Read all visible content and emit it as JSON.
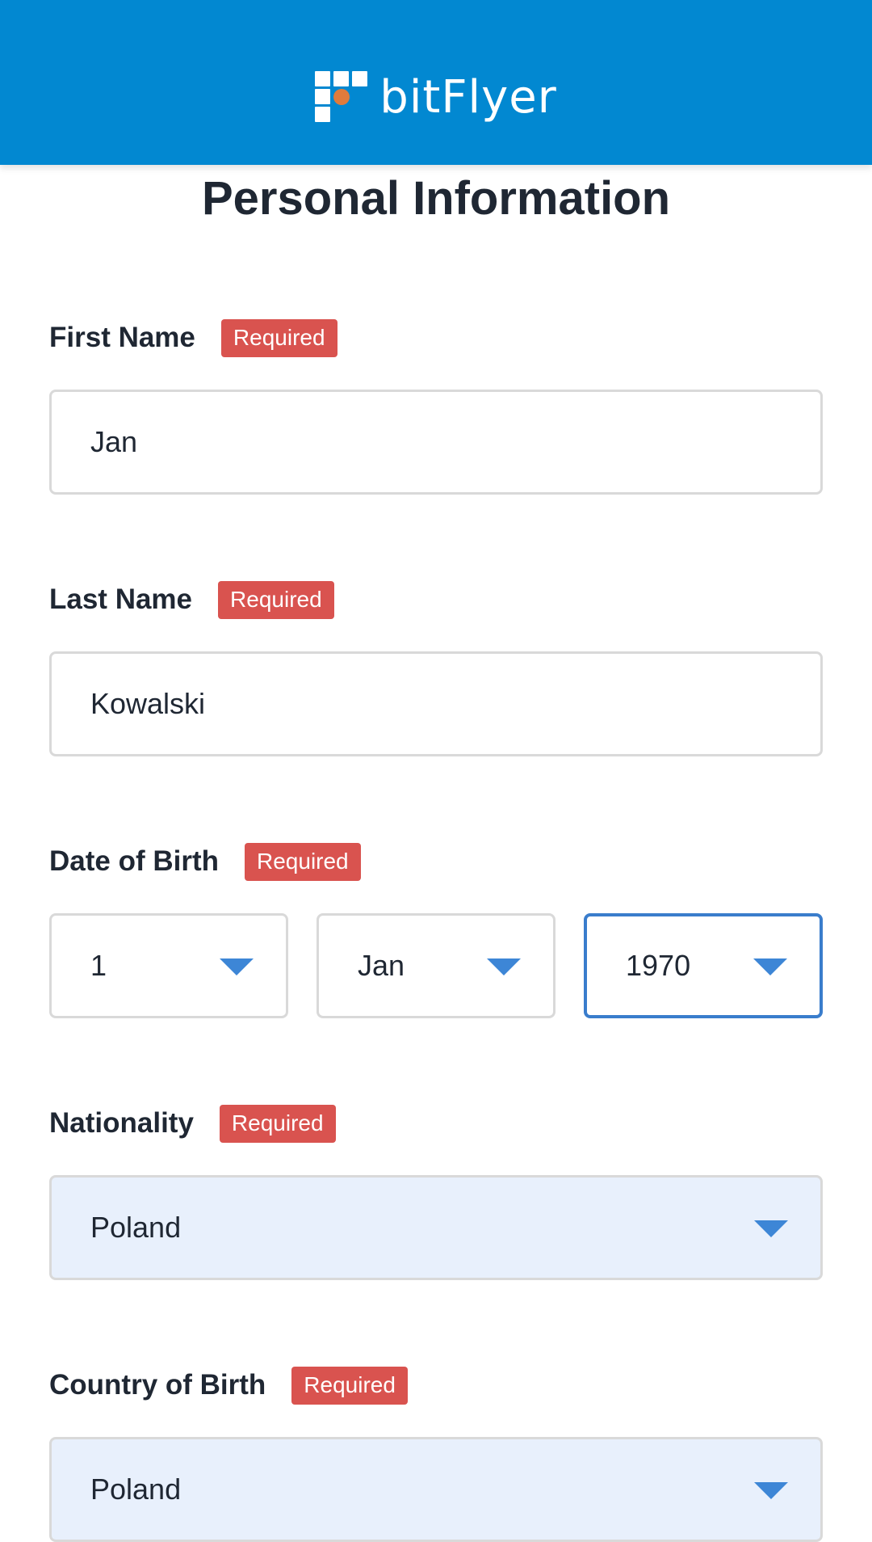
{
  "header": {
    "logo_text": "bitFlyer",
    "logo_icon": "bitflyer-logo-icon",
    "background_color": "#0288d1",
    "accent_color": "#e07b3c"
  },
  "page": {
    "title": "Personal Information"
  },
  "form": {
    "required_label": "Required",
    "first_name": {
      "label": "First Name",
      "value": "Jan"
    },
    "last_name": {
      "label": "Last Name",
      "value": "Kowalski"
    },
    "date_of_birth": {
      "label": "Date of Birth",
      "day": "1",
      "month": "Jan",
      "year": "1970"
    },
    "nationality": {
      "label": "Nationality",
      "value": "Poland"
    },
    "country_of_birth": {
      "label": "Country of Birth",
      "value": "Poland"
    }
  },
  "colors": {
    "required_badge": "#d9534f",
    "focus_border": "#3a7dcc",
    "dropdown_caret": "#3d86d6",
    "autofill_background": "#e8f0fc"
  }
}
